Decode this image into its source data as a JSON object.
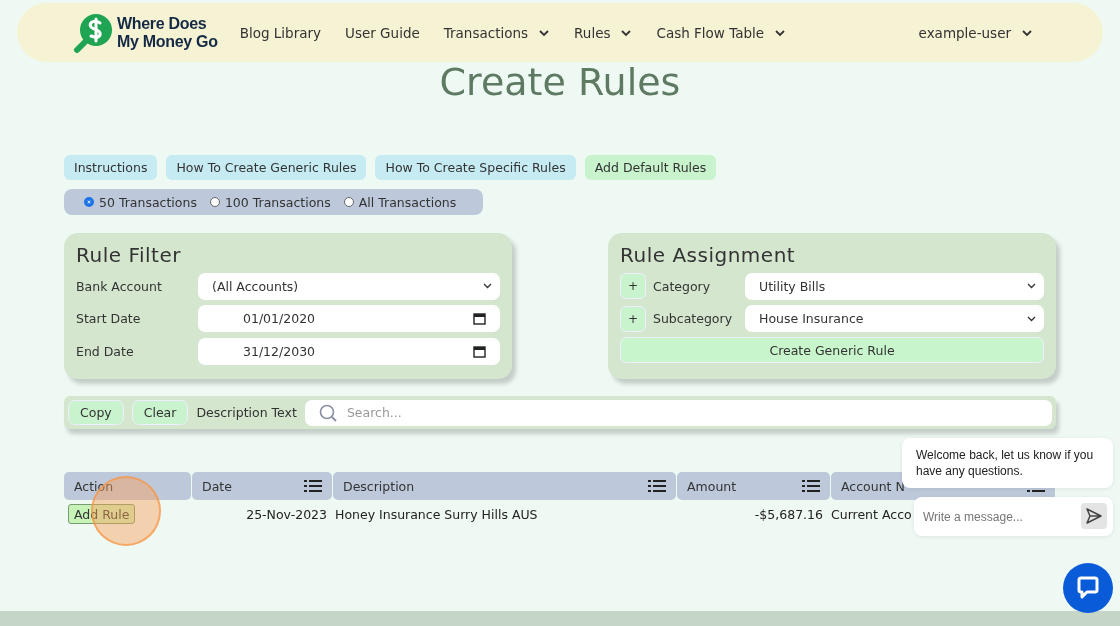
{
  "nav": {
    "logo": {
      "line1": "Where Does",
      "line2": "My Money Go"
    },
    "items": [
      {
        "label": "Blog Library",
        "dropdown": false
      },
      {
        "label": "User Guide",
        "dropdown": false
      },
      {
        "label": "Transactions",
        "dropdown": true
      },
      {
        "label": "Rules",
        "dropdown": true
      },
      {
        "label": "Cash Flow Table",
        "dropdown": true
      }
    ],
    "user": {
      "label": "example-user",
      "dropdown": true
    }
  },
  "title": "Create Rules",
  "help_buttons": [
    {
      "label": "Instructions",
      "kind": "info"
    },
    {
      "label": "How To Create Generic Rules",
      "kind": "info"
    },
    {
      "label": "How To Create Specific Rules",
      "kind": "info"
    },
    {
      "label": "Add Default Rules",
      "kind": "action"
    }
  ],
  "transaction_limit": [
    {
      "label": "50 Transactions",
      "selected": true
    },
    {
      "label": "100 Transactions",
      "selected": false
    },
    {
      "label": "All Transactions",
      "selected": false
    }
  ],
  "rule_filter": {
    "title": "Rule Filter",
    "fields": [
      {
        "label": "Bank Account",
        "kind": "select",
        "value": "(All Accounts)"
      },
      {
        "label": "Start Date",
        "kind": "date",
        "value": "01/01/2020"
      },
      {
        "label": "End Date",
        "kind": "date",
        "value": "31/12/2030"
      }
    ]
  },
  "rule_assignment": {
    "title": "Rule Assignment",
    "fields": [
      {
        "add": "+",
        "label": "Category",
        "value": "Utility Bills"
      },
      {
        "add": "+",
        "label": "Subcategory",
        "value": "House Insurance"
      }
    ],
    "button": "Create Generic Rule"
  },
  "toolbar": {
    "buttons": [
      "Copy",
      "Clear"
    ],
    "label": "Description Text",
    "placeholder": "Search..."
  },
  "table": {
    "columns": [
      {
        "label": "Action",
        "sortable": false
      },
      {
        "label": "Date",
        "sortable": true
      },
      {
        "label": "Description",
        "sortable": true
      },
      {
        "label": "Amount",
        "sortable": true
      },
      {
        "label": "Account N",
        "sortable": true
      }
    ],
    "rows": [
      {
        "action": "Add Rule",
        "date": "25-Nov-2023",
        "description": "Honey Insurance Surry Hills AUS",
        "amount": "-$5,687.16",
        "account": "Current Acco"
      }
    ]
  },
  "chat": {
    "message": "Welcome back, let us know if you have any questions.",
    "placeholder": "Write a message..."
  }
}
